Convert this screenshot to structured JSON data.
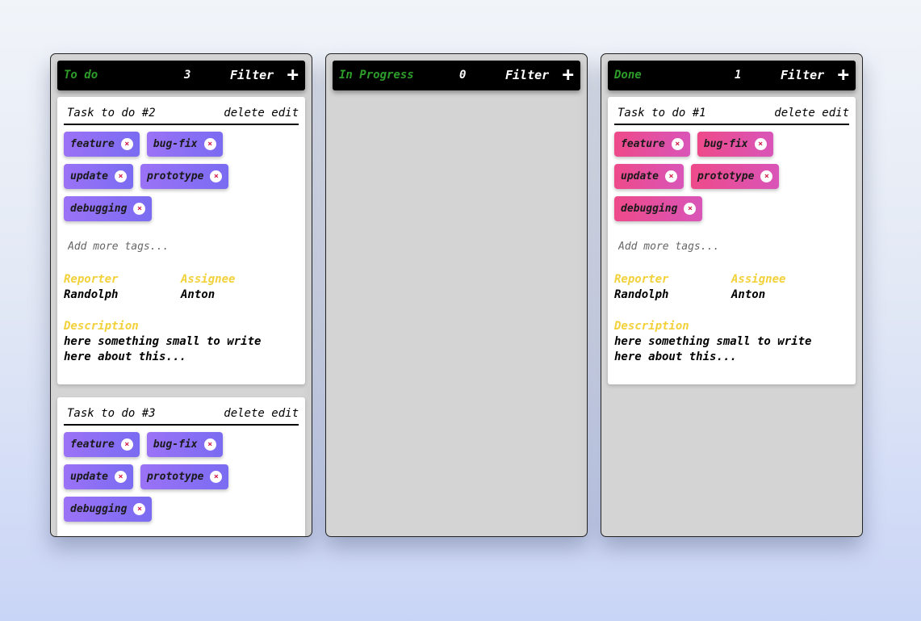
{
  "columns": [
    {
      "title": "To do",
      "count": "3",
      "filter_label": "Filter",
      "add_label": "+",
      "tag_color": "#8a6ff4",
      "cards": [
        {
          "title": "Task to do #2",
          "delete_label": "delete",
          "edit_label": "edit",
          "tags": [
            "feature",
            "bug-fix",
            "update",
            "prototype",
            "debugging"
          ],
          "tag_remove_label": "×",
          "add_tags_placeholder": "Add more tags...",
          "reporter_label": "Reporter",
          "reporter": "Randolph",
          "assignee_label": "Assignee",
          "assignee": "Anton",
          "description_label": "Description",
          "description": "here something small to write here about this..."
        },
        {
          "title": "Task to do #3",
          "delete_label": "delete",
          "edit_label": "edit",
          "tags": [
            "feature",
            "bug-fix",
            "update",
            "prototype",
            "debugging"
          ],
          "tag_remove_label": "×"
        }
      ]
    },
    {
      "title": "In Progress",
      "count": "0",
      "filter_label": "Filter",
      "add_label": "+",
      "cards": []
    },
    {
      "title": "Done",
      "count": "1",
      "filter_label": "Filter",
      "add_label": "+",
      "tag_color": "#e84e97",
      "cards": [
        {
          "title": "Task to do #1",
          "delete_label": "delete",
          "edit_label": "edit",
          "tags": [
            "feature",
            "bug-fix",
            "update",
            "prototype",
            "debugging"
          ],
          "tag_remove_label": "×",
          "add_tags_placeholder": "Add more tags...",
          "reporter_label": "Reporter",
          "reporter": "Randolph",
          "assignee_label": "Assignee",
          "assignee": "Anton",
          "description_label": "Description",
          "description": "here something small to write here about this..."
        }
      ]
    }
  ],
  "colors": {
    "column_title": "#2e9d2a",
    "field_label": "#f2d13a",
    "column_bg": "#d4d4d4"
  }
}
